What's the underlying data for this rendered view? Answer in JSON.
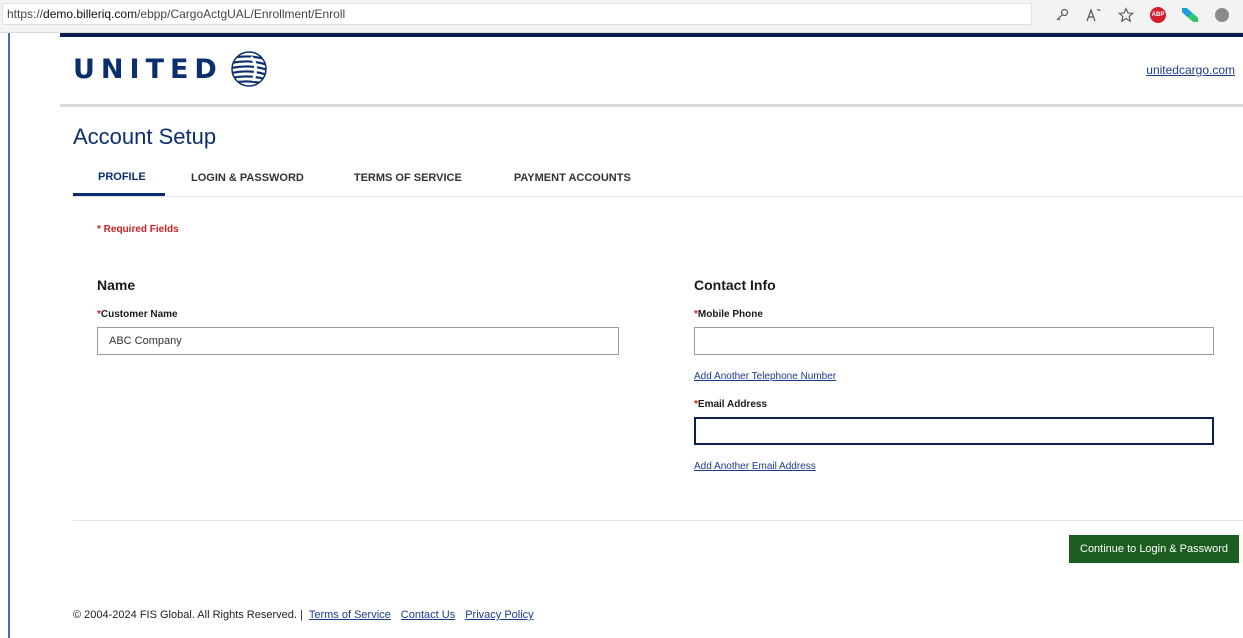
{
  "browser": {
    "url_prefix": "https://",
    "url_domain": "demo.billeriq.com",
    "url_path": "/ebpp/CargoActgUAL/Enrollment/Enroll",
    "icons": [
      "key-icon",
      "read-aloud-icon",
      "favorite-star-icon",
      "adblock-icon",
      "extension-icon",
      "profile-icon"
    ]
  },
  "header": {
    "logo_text": "UNITED",
    "link": "unitedcargo.com"
  },
  "page": {
    "title": "Account Setup",
    "tabs": [
      {
        "label": "PROFILE",
        "active": true
      },
      {
        "label": "LOGIN & PASSWORD",
        "active": false
      },
      {
        "label": "TERMS OF SERVICE",
        "active": false
      },
      {
        "label": "PAYMENT ACCOUNTS",
        "active": false
      }
    ],
    "required_note": "* Required Fields"
  },
  "name_section": {
    "heading": "Name",
    "customer_name_label": "Customer Name",
    "customer_name_value": "ABC Company"
  },
  "contact_section": {
    "heading": "Contact Info",
    "mobile_label": "Mobile Phone",
    "mobile_value": "",
    "add_phone_link": "Add Another Telephone Number",
    "email_label": "Email Address",
    "email_value": "",
    "add_email_link": "Add Another Email Address"
  },
  "actions": {
    "continue_label": "Continue to Login & Password"
  },
  "footer": {
    "copyright": "© 2004-2024 FIS Global. All Rights Reserved. |",
    "terms": "Terms of Service",
    "contact": "Contact Us",
    "privacy": "Privacy Policy"
  },
  "colors": {
    "brand_navy": "#0b2f6e",
    "required_red": "#cc1f1f",
    "button_green": "#1b5e20",
    "link_blue": "#1a3b8c"
  }
}
